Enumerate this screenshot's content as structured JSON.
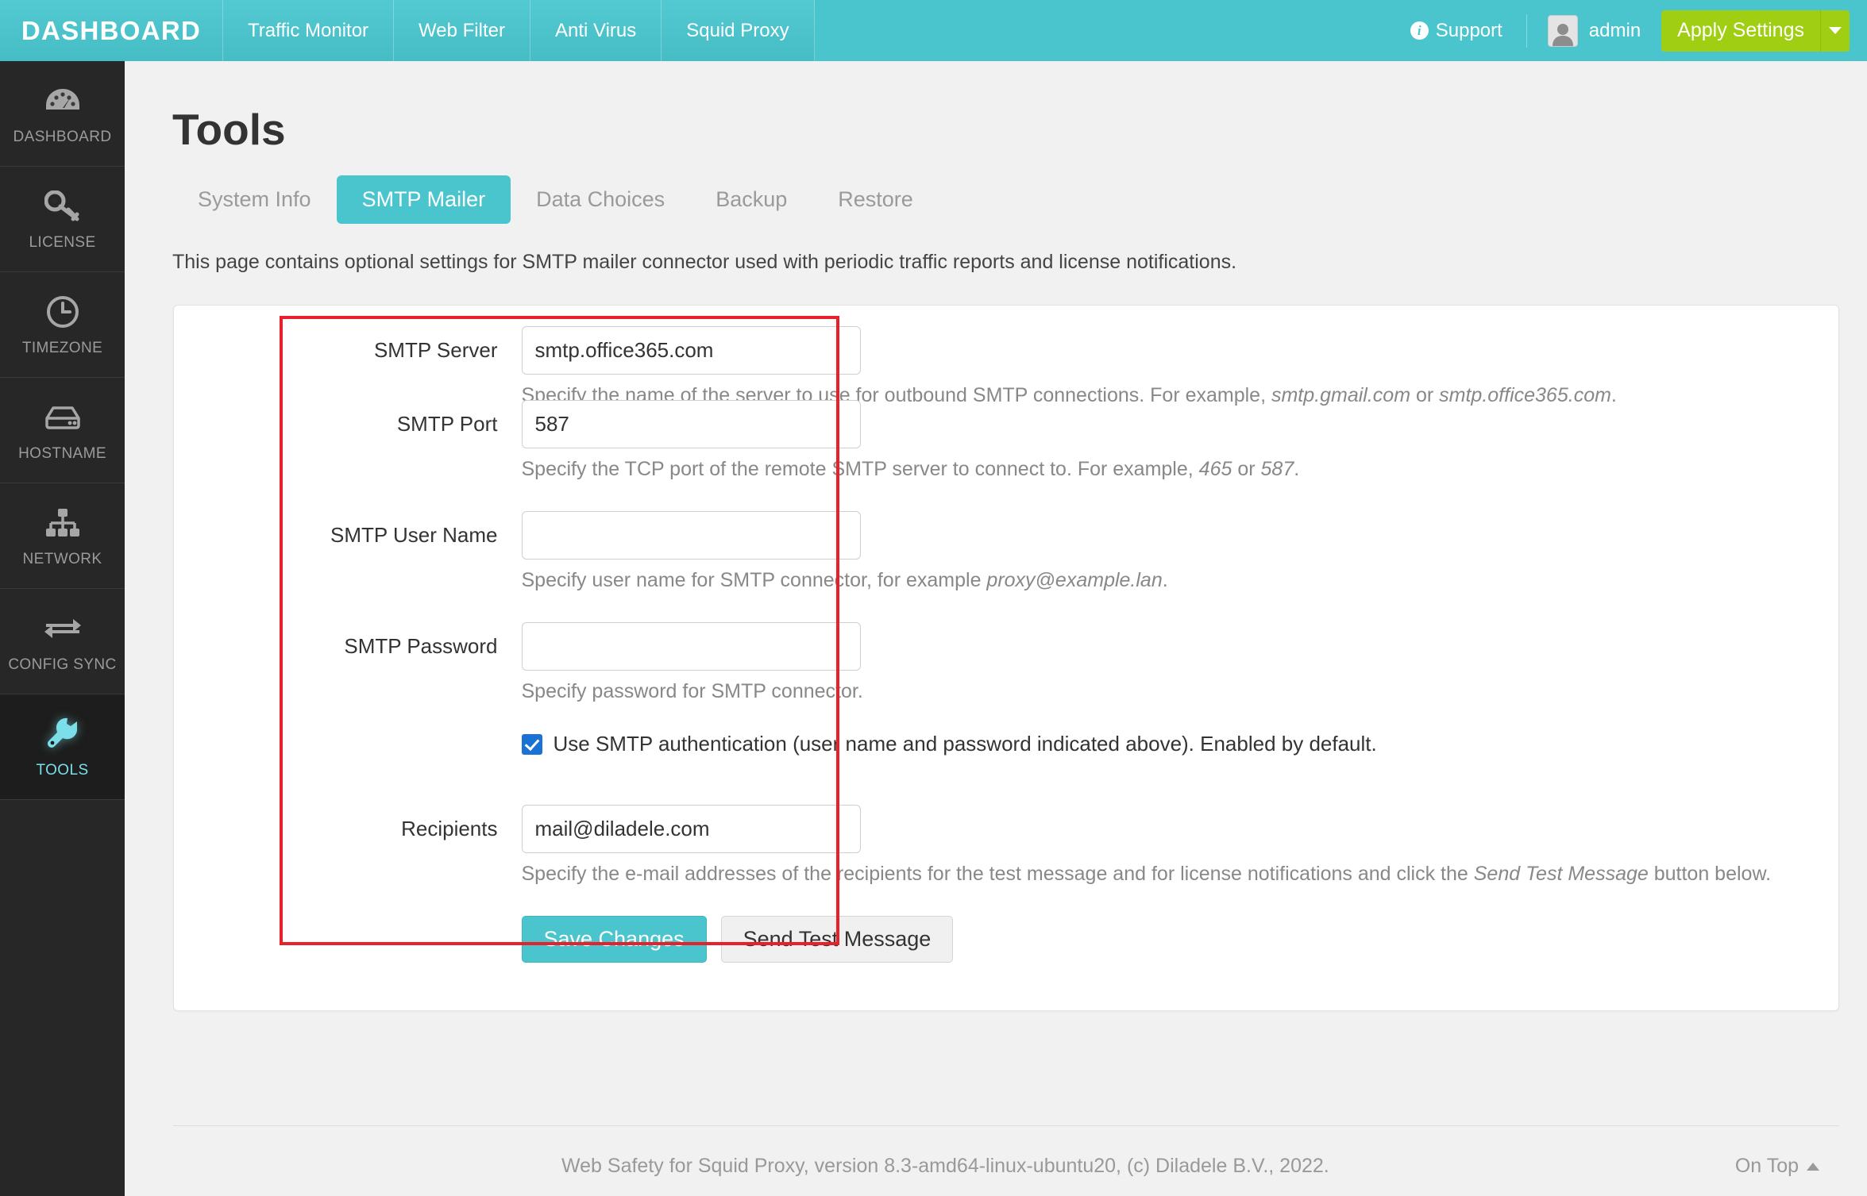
{
  "topbar": {
    "brand": "DASHBOARD",
    "nav": [
      {
        "label": "Traffic Monitor"
      },
      {
        "label": "Web Filter"
      },
      {
        "label": "Anti Virus"
      },
      {
        "label": "Squid Proxy"
      }
    ],
    "support_label": "Support",
    "support_icon": "info-circle-icon",
    "user_name": "admin",
    "user_icon": "user-avatar-icon",
    "apply_label": "Apply Settings",
    "apply_caret_icon": "chevron-down-icon",
    "accent_teal": "#4bc5cd",
    "apply_green": "#a0ce12"
  },
  "sidebar": {
    "items": [
      {
        "label": "DASHBOARD",
        "icon": "gauge-icon",
        "active": false
      },
      {
        "label": "LICENSE",
        "icon": "key-icon",
        "active": false
      },
      {
        "label": "TIMEZONE",
        "icon": "clock-icon",
        "active": false
      },
      {
        "label": "HOSTNAME",
        "icon": "server-icon",
        "active": false
      },
      {
        "label": "NETWORK",
        "icon": "sitemap-icon",
        "active": false
      },
      {
        "label": "CONFIG SYNC",
        "icon": "exchange-arrows-icon",
        "active": false
      },
      {
        "label": "TOOLS",
        "icon": "wrench-icon",
        "active": true
      }
    ],
    "active_color": "#7adfe8"
  },
  "main": {
    "title": "Tools",
    "tabs": [
      {
        "label": "System Info",
        "active": false
      },
      {
        "label": "SMTP Mailer",
        "active": true
      },
      {
        "label": "Data Choices",
        "active": false
      },
      {
        "label": "Backup",
        "active": false
      },
      {
        "label": "Restore",
        "active": false
      }
    ],
    "intro": "This page contains optional settings for SMTP mailer connector used with periodic traffic reports and license notifications."
  },
  "form": {
    "smtp_server": {
      "label": "SMTP Server",
      "value": "smtp.office365.com",
      "placeholder": "",
      "help_pre": "Specify the name of the server to use for outbound SMTP connections. For example, ",
      "help_em1": "smtp.gmail.com",
      "help_mid": " or ",
      "help_em2": "smtp.office365.com",
      "help_post": "."
    },
    "smtp_port": {
      "label": "SMTP Port",
      "value": "587",
      "placeholder": "",
      "help_pre": "Specify the TCP port of the remote SMTP server to connect to. For example, ",
      "help_em1": "465",
      "help_mid": " or ",
      "help_em2": "587",
      "help_post": "."
    },
    "smtp_user": {
      "label": "SMTP User Name",
      "value": "",
      "placeholder": "",
      "help_pre": "Specify user name for SMTP connector, for example ",
      "help_em1": "proxy@example.lan",
      "help_post": "."
    },
    "smtp_password": {
      "label": "SMTP Password",
      "value": "",
      "placeholder": "",
      "help_pre": "Specify password for SMTP connector."
    },
    "use_auth": {
      "label": "Use SMTP authentication (user name and password indicated above). Enabled by default.",
      "checked": true,
      "check_color": "#1a73d4"
    },
    "recipients": {
      "label": "Recipients",
      "value": "mail@diladele.com",
      "placeholder": "",
      "help_pre": "Specify the e-mail addresses of the recipients for the test message and for license notifications and click the ",
      "help_em1": "Send Test Message",
      "help_post": " button below."
    },
    "save_label": "Save Changes",
    "test_label": "Send Test Message"
  },
  "annotation": {
    "color": "#e8202a",
    "name": "red-highlight-rectangle"
  },
  "footer": {
    "text": "Web Safety for Squid Proxy, version 8.3-amd64-linux-ubuntu20, (c) Diladele B.V., 2022.",
    "on_top_label": "On Top",
    "on_top_icon": "chevron-up-icon"
  }
}
